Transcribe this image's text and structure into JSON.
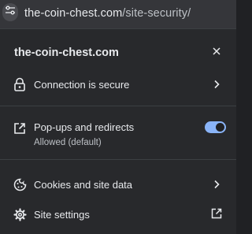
{
  "address_bar": {
    "domain": "the-coin-chest.com",
    "path": "/site-security/",
    "site_info_icon": "tune-icon"
  },
  "panel": {
    "title": "the-coin-chest.com",
    "close_icon": "close-icon",
    "connection": {
      "label": "Connection is secure",
      "icon": "lock-icon"
    },
    "popups": {
      "label": "Pop-ups and redirects",
      "status": "Allowed (default)",
      "icon": "external-window-icon",
      "enabled": true
    },
    "cookies": {
      "label": "Cookies and site data",
      "icon": "cookie-icon"
    },
    "site_settings": {
      "label": "Site settings",
      "icon": "gear-icon"
    }
  },
  "colors": {
    "accent": "#8ab4f8",
    "panel_bg": "#28292c",
    "text": "#e8eaed"
  }
}
